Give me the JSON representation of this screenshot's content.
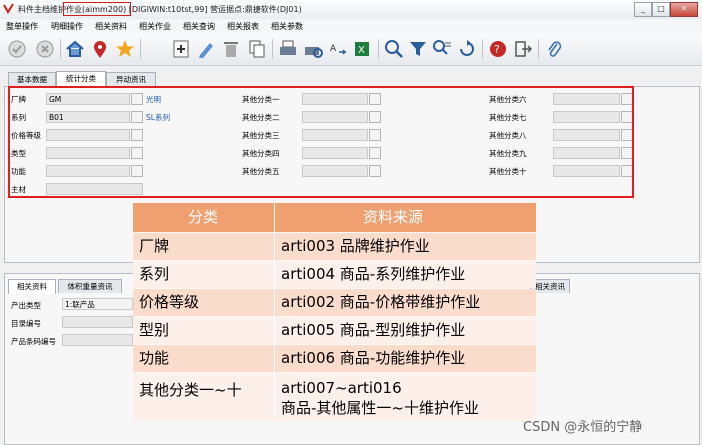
{
  "window": {
    "title": "料件主档维护作业(aimm200)   [DIGIWIN:t10tst,99]   营运据点:鼎捷软件(DJ01)",
    "minimize_icon": "minimize-icon",
    "maximize_icon": "maximize-icon",
    "close_icon": "close-icon"
  },
  "menu": [
    "整单操作",
    "明细操作",
    "相关资料",
    "相关作业",
    "相关查询",
    "相关报表",
    "相关参数"
  ],
  "toolbar": [
    "check-icon",
    "cancel-icon",
    "home-icon",
    "location-pin-icon",
    "star-icon",
    "add-icon",
    "edit-icon",
    "delete-icon",
    "copy-icon",
    "print-icon",
    "print-preview-icon",
    "convert-icon",
    "excel-export-icon",
    "search-icon",
    "filter-icon",
    "advanced-search-icon",
    "refresh-icon",
    "help-icon",
    "exit-icon",
    "attachment-icon"
  ],
  "tabs": [
    "基本数据",
    "统计分类",
    "异动资讯"
  ],
  "fields": {
    "brand": {
      "label": "厂牌",
      "value": "GM",
      "desc": "光明"
    },
    "series": {
      "label": "系列",
      "value": "B01",
      "desc": "SL系列"
    },
    "price_level": {
      "label": "价格等级",
      "value": ""
    },
    "type": {
      "label": "类型",
      "value": ""
    },
    "function": {
      "label": "功能",
      "value": ""
    },
    "main_material": {
      "label": "主材",
      "value": ""
    }
  },
  "other_categories_mid": [
    "其他分类一",
    "其他分类二",
    "其他分类三",
    "其他分类四",
    "其他分类五"
  ],
  "other_categories_right": [
    "其他分类六",
    "其他分类七",
    "其他分类八",
    "其他分类九",
    "其他分类十"
  ],
  "lower_tabs": [
    "相关资料",
    "体积重量资讯",
    "相关资讯"
  ],
  "lower_fields": {
    "product_type": {
      "label": "产出类型",
      "value": "1:联产品"
    },
    "catalog_no": {
      "label": "目录编号",
      "value": ""
    },
    "barcode": {
      "label": "产品条码编号",
      "value": ""
    }
  },
  "overlay_table": {
    "headers": [
      "分类",
      "资料来源"
    ],
    "rows": [
      [
        "厂牌",
        "arti003 品牌维护作业"
      ],
      [
        "系列",
        "arti004 商品-系列维护作业"
      ],
      [
        "价格等级",
        "arti002 商品-价格带维护作业"
      ],
      [
        "型别",
        "arti005 商品-型别维护作业"
      ],
      [
        "功能",
        "arti006 商品-功能维护作业"
      ],
      [
        "其他分类一~十",
        "arti007~arti016",
        "商品-其他属性一~十维护作业"
      ]
    ]
  },
  "watermark": "CSDN @永恒的宁静",
  "colors": {
    "highlight_border": "#e02020",
    "overlay_header": "#f0a070",
    "link": "#1a5fb4"
  }
}
